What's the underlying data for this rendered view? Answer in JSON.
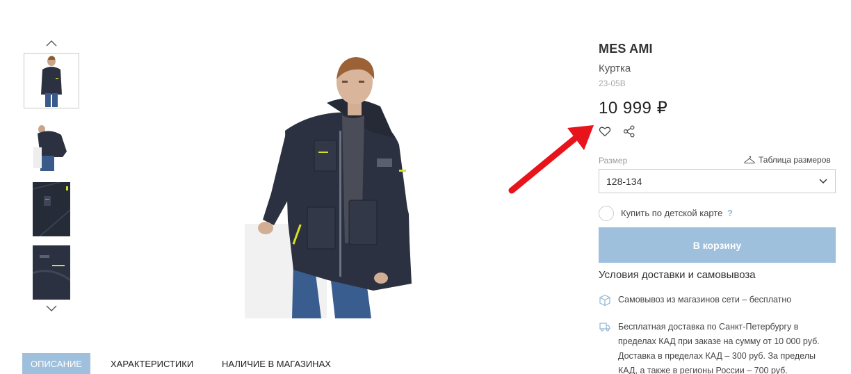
{
  "gallery": {
    "thumbnails": [
      {
        "alt": "jacket-full-front",
        "active": true
      },
      {
        "alt": "jacket-side"
      },
      {
        "alt": "jacket-detail-pocket"
      },
      {
        "alt": "jacket-detail-sleeve"
      }
    ],
    "prev_icon": "chevron-up-icon",
    "next_icon": "chevron-down-icon"
  },
  "product": {
    "brand": "MES AMI",
    "type": "Куртка",
    "sku": "23-05B",
    "price": "10 999 ₽",
    "favorite_icon": "heart-icon",
    "share_icon": "share-icon"
  },
  "size": {
    "label": "Размер",
    "table_link": "Таблица размеров",
    "selected": "128-134"
  },
  "kids_card": {
    "label": "Купить по детской карте",
    "help": "?"
  },
  "cart": {
    "button_label": "В корзину"
  },
  "delivery": {
    "title": "Условия доставки и самовывоза",
    "pickup": "Самовывоз из магазинов сети – бесплатно",
    "free_delivery_lines": [
      "Бесплатная доставка по Санкт-Петербургу в",
      "пределах КАД при заказе на сумму от 10 000 руб.",
      "Доставка в пределах КАД – 300 руб. За пределы",
      "КАД, а также в регионы России – 700 руб."
    ]
  },
  "tabs": [
    {
      "label": "Описание",
      "active": true
    },
    {
      "label": "Характеристики"
    },
    {
      "label": "Наличие в магазинах"
    }
  ],
  "colors": {
    "accent": "#9ec0dc",
    "annotation_arrow": "#e8141c",
    "jacket": "#2b3140"
  }
}
